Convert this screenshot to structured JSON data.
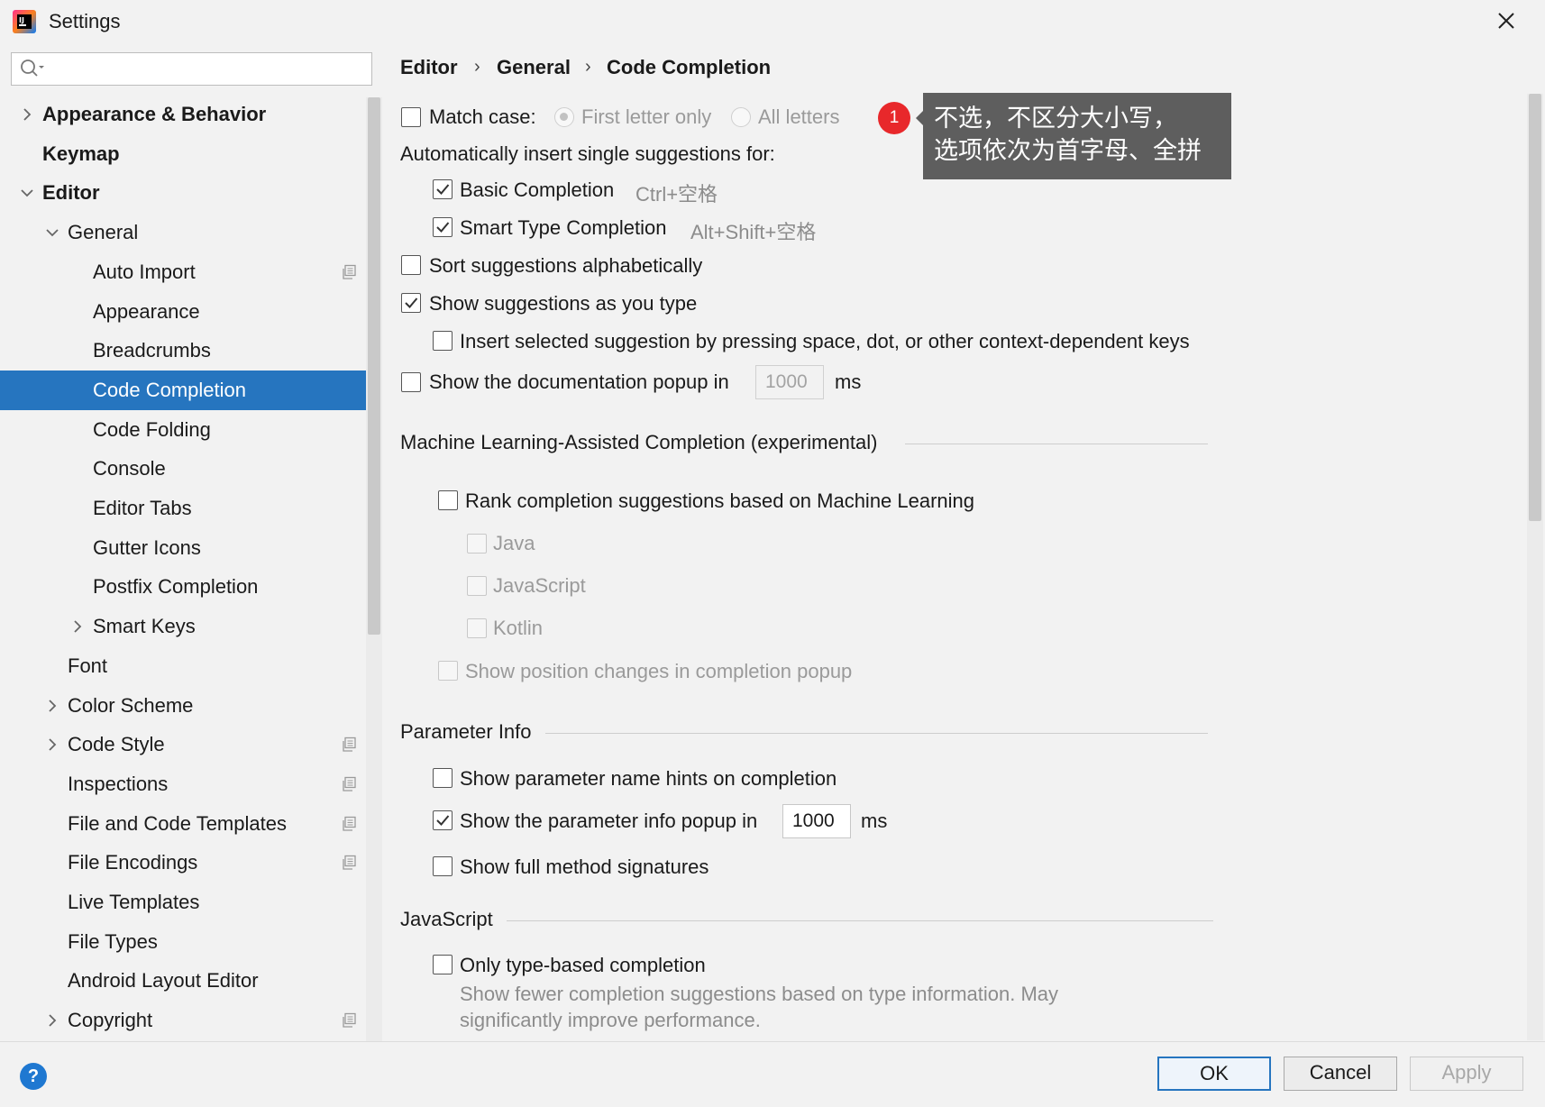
{
  "window": {
    "title": "Settings"
  },
  "sidebar": {
    "search_placeholder": "",
    "items": [
      {
        "label": "Appearance & Behavior",
        "bold": true,
        "chevron": "right"
      },
      {
        "label": "Keymap",
        "bold": true
      },
      {
        "label": "Editor",
        "bold": true,
        "chevron": "down"
      },
      {
        "label": "General",
        "chevron": "down"
      },
      {
        "label": "Auto Import",
        "copy_icon": true
      },
      {
        "label": "Appearance"
      },
      {
        "label": "Breadcrumbs"
      },
      {
        "label": "Code Completion",
        "selected": true
      },
      {
        "label": "Code Folding"
      },
      {
        "label": "Console"
      },
      {
        "label": "Editor Tabs"
      },
      {
        "label": "Gutter Icons"
      },
      {
        "label": "Postfix Completion"
      },
      {
        "label": "Smart Keys",
        "chevron": "right"
      },
      {
        "label": "Font"
      },
      {
        "label": "Color Scheme",
        "chevron": "right"
      },
      {
        "label": "Code Style",
        "chevron": "right",
        "copy_icon": true
      },
      {
        "label": "Inspections",
        "copy_icon": true
      },
      {
        "label": "File and Code Templates",
        "copy_icon": true
      },
      {
        "label": "File Encodings",
        "copy_icon": true
      },
      {
        "label": "Live Templates"
      },
      {
        "label": "File Types"
      },
      {
        "label": "Android Layout Editor"
      },
      {
        "label": "Copyright",
        "chevron": "right",
        "copy_icon": true
      }
    ]
  },
  "breadcrumb": [
    "Editor",
    "General",
    "Code Completion"
  ],
  "main": {
    "match_case": {
      "label": "Match case:",
      "checked": false
    },
    "first_letter_only": {
      "label": "First letter only",
      "selected": true,
      "enabled": false
    },
    "all_letters": {
      "label": "All letters",
      "selected": false,
      "enabled": false
    },
    "auto_insert_heading": "Automatically insert single suggestions for:",
    "basic_completion": {
      "label": "Basic Completion",
      "shortcut": "Ctrl+空格",
      "checked": true
    },
    "smart_type_completion": {
      "label": "Smart Type Completion",
      "shortcut": "Alt+Shift+空格",
      "checked": true
    },
    "sort_alpha": {
      "label": "Sort suggestions alphabetically",
      "checked": false
    },
    "show_as_type": {
      "label": "Show suggestions as you type",
      "checked": true
    },
    "insert_selected": {
      "label": "Insert selected suggestion by pressing space, dot, or other context-dependent keys",
      "checked": false
    },
    "doc_popup": {
      "label": "Show the documentation popup in",
      "value": "1000",
      "unit": "ms",
      "checked": false
    },
    "ml_section": {
      "title": "Machine Learning-Assisted Completion (experimental)",
      "rank": {
        "label": "Rank completion suggestions based on Machine Learning",
        "checked": false
      },
      "java": "Java",
      "javascript": "JavaScript",
      "kotlin": "Kotlin",
      "position_changes": "Show position changes in completion popup"
    },
    "param_section": {
      "title": "Parameter Info",
      "name_hints": {
        "label": "Show parameter name hints on completion",
        "checked": false
      },
      "info_popup": {
        "label": "Show the parameter info popup in",
        "value": "1000",
        "unit": "ms",
        "checked": true
      },
      "full_signatures": {
        "label": "Show full method signatures",
        "checked": false
      }
    },
    "js_section": {
      "title": "JavaScript",
      "type_based": {
        "label": "Only type-based completion",
        "checked": false
      },
      "desc_line1": "Show fewer completion suggestions based on type information. May",
      "desc_line2": "significantly improve performance."
    }
  },
  "annotation": {
    "badge": "1",
    "line1": "不选，不区分大小写，",
    "line2": "选项依次为首字母、全拼"
  },
  "buttons": {
    "ok": "OK",
    "cancel": "Cancel",
    "apply": "Apply",
    "help": "?"
  },
  "colors": {
    "selection": "#2675bf",
    "badge": "#e8282b",
    "annotation_bg": "#5e5e5e"
  }
}
